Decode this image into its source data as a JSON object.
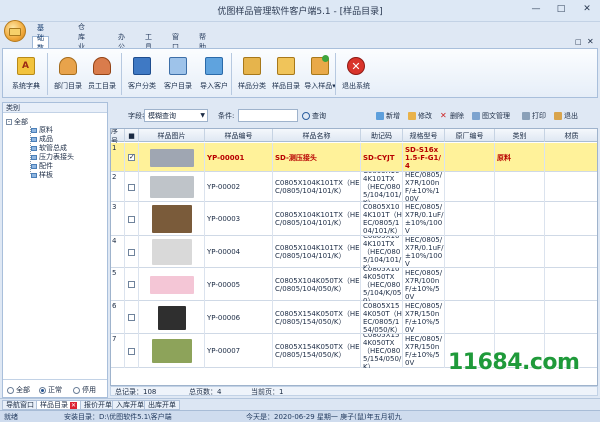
{
  "window": {
    "title": "优图样品管理软件客户端5.1 - [样品目录]"
  },
  "menu_tabs": [
    "基础数据",
    "仓库业务",
    "办公",
    "工具",
    "窗口",
    "帮助"
  ],
  "ribbon": {
    "buttons": [
      "系统字典",
      "部门目录",
      "员工目录",
      "客户分类",
      "客户目录",
      "导入客户",
      "样品分类",
      "样品目录",
      "导入样品",
      "退出系统"
    ],
    "dropdown_marker": "▾"
  },
  "left_panel": {
    "header": "类别",
    "tree_root": "全部",
    "tree_toggle": "-",
    "tree_children": [
      "原料",
      "成品",
      "软管总成",
      "压力表接头",
      "配件",
      "样板"
    ],
    "radios": [
      "全部",
      "正常",
      "停用"
    ],
    "radio_selected": 1
  },
  "search": {
    "field_label": "字段名:",
    "field_value": "模糊查询",
    "cond_label": "条件:",
    "search_btn": "查询",
    "actions": [
      "新增",
      "修改",
      "删除",
      "图文管理",
      "打印",
      "退出"
    ]
  },
  "table": {
    "columns": [
      "序号",
      "■",
      "样品图片",
      "样品编号",
      "样品名称",
      "助记码",
      "规格型号",
      "原厂编号",
      "类别",
      "材质"
    ],
    "rows": [
      {
        "no": "1",
        "code": "YP-00001",
        "name": "SD-测压接头",
        "mnemonic": "SD-CYJT",
        "spec": "SD-S16x1.5-F-G1/4",
        "cat": "原料",
        "checked": true
      },
      {
        "no": "2",
        "code": "YP-00002",
        "name": "C0805X104K101TX（HEC/0805/104/101/K）",
        "mnemonic": "C0805X104K101TX（HEC/0805/104/101/K）",
        "spec": "HEC/0805/X7R/100nF/±10%/100V",
        "cat": "",
        "checked": false
      },
      {
        "no": "3",
        "code": "YP-00003",
        "name": "C0805X104K101TX（HEC/0805/104/101/K）",
        "mnemonic": "C0805X104K101T（HEC/0805/104/101/K）",
        "spec": "HEC/0805/X7R/0.1uF/±10%/100V",
        "cat": "",
        "checked": false
      },
      {
        "no": "4",
        "code": "YP-00004",
        "name": "C0805X104K101TX（HEC/0805/104/101/K）",
        "mnemonic": "C0805X104K101TX（HEC/0805/104/101/K）",
        "spec": "HEC/0805/X7R/0.1uF/±10%/100V",
        "cat": "",
        "checked": false
      },
      {
        "no": "5",
        "code": "YP-00005",
        "name": "C0805X104K050TX（HEC/0805/104/050/K）",
        "mnemonic": "C0805X104K050TX（HEC/0805/104/K/050）",
        "spec": "HEC/0805/X7R/100nF/±10%/50V",
        "cat": "",
        "checked": false
      },
      {
        "no": "6",
        "code": "YP-00006",
        "name": "C0805X154K050TX（HEC/0805/154/050/K）",
        "mnemonic": "C0805X154K050T（HEC/0805/154/050/K）",
        "spec": "HEC/0805/X7R/150nF/±10%/50V",
        "cat": "",
        "checked": false
      },
      {
        "no": "7",
        "code": "YP-00007",
        "name": "C0805X154K050TX（HEC/0805/154/050/K）",
        "mnemonic": "C0805X154K050TX（HEC/0805/154/050/K）",
        "spec": "HEC/0805/X7R/150nF/±10%/50V",
        "cat": "",
        "checked": false
      }
    ]
  },
  "grid_footer": {
    "total_records": "总记录：108",
    "total_pages": "总页数：4",
    "current_page": "当前页：1"
  },
  "bottom_tabs": [
    "导航窗口",
    "样品目录",
    "报价开单",
    "入库开单",
    "出库开单"
  ],
  "status": {
    "ready": "就绪",
    "install_dir": "安装目录：D:\\优图软件5.1\\客户端",
    "today": "今天是：2020-06-29 星期一 庚子(鼠)年五月初九"
  },
  "watermark": "11684.com",
  "colors": {
    "selected_row": "#fff29a",
    "highlight_text": "#b80000",
    "ribbon_border": "#a9bfdb"
  }
}
